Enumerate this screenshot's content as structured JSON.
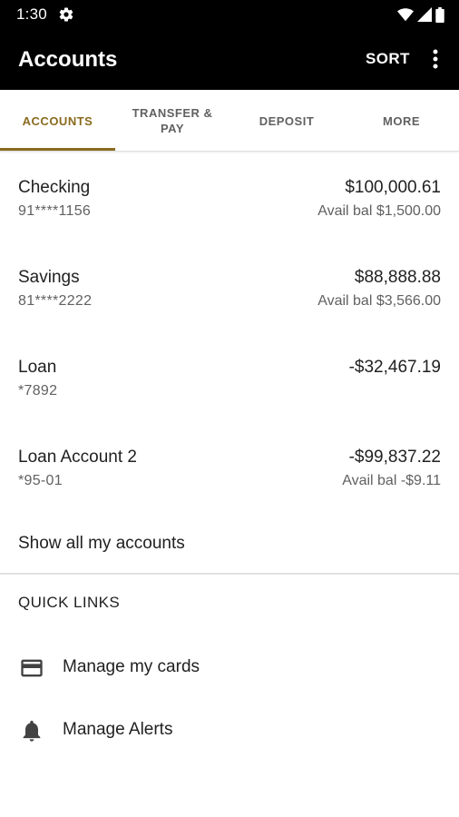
{
  "status_bar": {
    "time": "1:30",
    "icons": [
      "gear-icon",
      "wifi-icon",
      "signal-icon",
      "battery-icon"
    ]
  },
  "app_bar": {
    "title": "Accounts",
    "sort_label": "SORT",
    "overflow_icon": "more-vert-icon"
  },
  "tabs": [
    {
      "label": "ACCOUNTS",
      "active": true
    },
    {
      "label": "TRANSFER & PAY",
      "active": false
    },
    {
      "label": "DEPOSIT",
      "active": false
    },
    {
      "label": "MORE",
      "active": false
    }
  ],
  "accounts": [
    {
      "name": "Checking",
      "number": "91****1156",
      "balance": "$100,000.61",
      "available": "Avail bal $1,500.00"
    },
    {
      "name": "Savings",
      "number": "81****2222",
      "balance": "$88,888.88",
      "available": "Avail bal $3,566.00"
    },
    {
      "name": "Loan",
      "number": "*7892",
      "balance": "-$32,467.19",
      "available": ""
    },
    {
      "name": "Loan Account 2",
      "number": "*95-01",
      "balance": "-$99,837.22",
      "available": "Avail bal -$9.11"
    }
  ],
  "show_all_label": "Show all my accounts",
  "quick_links": {
    "title": "QUICK LINKS",
    "items": [
      {
        "label": "Manage my cards",
        "icon": "credit-card-icon"
      },
      {
        "label": "Manage Alerts",
        "icon": "bell-icon"
      }
    ]
  },
  "colors": {
    "app_bar_bg": "#000000",
    "accent": "#8a6a1e",
    "text_primary": "#212121",
    "text_secondary": "#616161"
  }
}
